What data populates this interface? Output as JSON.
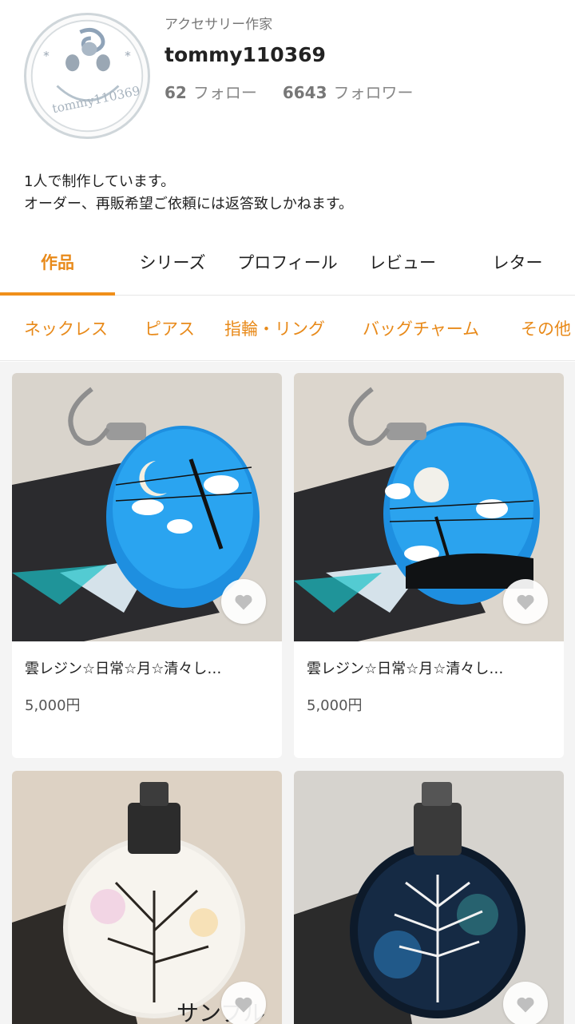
{
  "profile": {
    "category": "アクセサリー作家",
    "username": "tommy110369",
    "following_count": "62",
    "following_label": "フォロー",
    "followers_count": "6643",
    "followers_label": "フォロワー",
    "avatar_text": "tommy110369",
    "bio_lines": [
      "1人で制作しています。",
      "オーダー、再販希望ご依頼には返答致しかねます。"
    ]
  },
  "tabs": [
    {
      "label": "作品",
      "active": true
    },
    {
      "label": "シリーズ",
      "active": false
    },
    {
      "label": "プロフィール",
      "active": false
    },
    {
      "label": "レビュー",
      "active": false
    },
    {
      "label": "レター",
      "active": false
    }
  ],
  "categories": [
    "ネックレス",
    "ピアス",
    "指輪・リング",
    "バッグチャーム",
    "その他"
  ],
  "products": [
    {
      "title": "雲レジン☆日常☆月☆清々し…",
      "price": "5,000円",
      "image": "blue-resin-charm-crescent-moon"
    },
    {
      "title": "雲レジン☆日常☆月☆清々し…",
      "price": "5,000円",
      "image": "blue-resin-charm-full-moon"
    },
    {
      "title": "",
      "price": "",
      "image": "clear-globe-tree-pendant",
      "overlay_text": "サンプル"
    },
    {
      "title": "",
      "price": "",
      "image": "dark-globe-white-tree-pendant"
    }
  ],
  "colors": {
    "accent": "#e88a1a",
    "background": "#f4f4f4",
    "resin_blue": "#1e8fe0"
  }
}
